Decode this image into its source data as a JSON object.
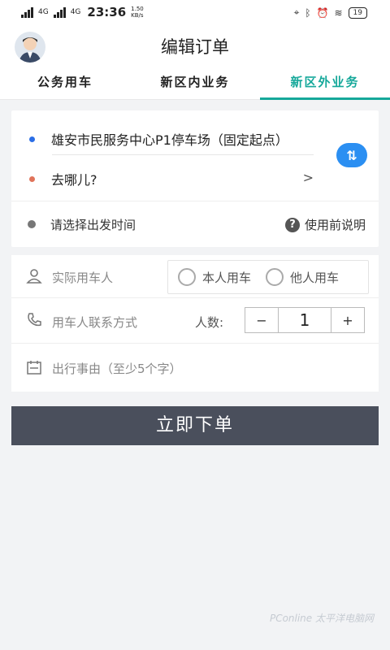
{
  "status_bar": {
    "net1": "4G",
    "net2": "4G",
    "time": "23:36",
    "speed_value": "1.50",
    "speed_unit": "KB/s",
    "battery": "19"
  },
  "header": {
    "title": "编辑订单"
  },
  "tabs": [
    {
      "label": "公务用车",
      "active": false
    },
    {
      "label": "新区内业务",
      "active": false
    },
    {
      "label": "新区外业务",
      "active": true
    }
  ],
  "route": {
    "from": "雄安市民服务中心P1停车场（固定起点）",
    "to": "去哪儿?",
    "to_arrow": ">",
    "time_placeholder": "请选择出发时间",
    "help": "使用前说明",
    "help_icon": "?"
  },
  "form": {
    "passenger_label": "实际用车人",
    "option_self": "本人用车",
    "option_other": "他人用车",
    "contact_label": "用车人联系方式",
    "count_label": "人数:",
    "minus": "−",
    "count_value": "1",
    "plus": "+",
    "reason_label": "出行事由（至少5个字）"
  },
  "submit_label": "立即下单",
  "colors": {
    "accent": "#15a89a",
    "from_dot": "#2b6ee6",
    "to_dot": "#e0735a",
    "swap": "#2b8ff2",
    "submit_bg": "#4a4f5c"
  },
  "watermark": "PConline 太平洋电脑网"
}
